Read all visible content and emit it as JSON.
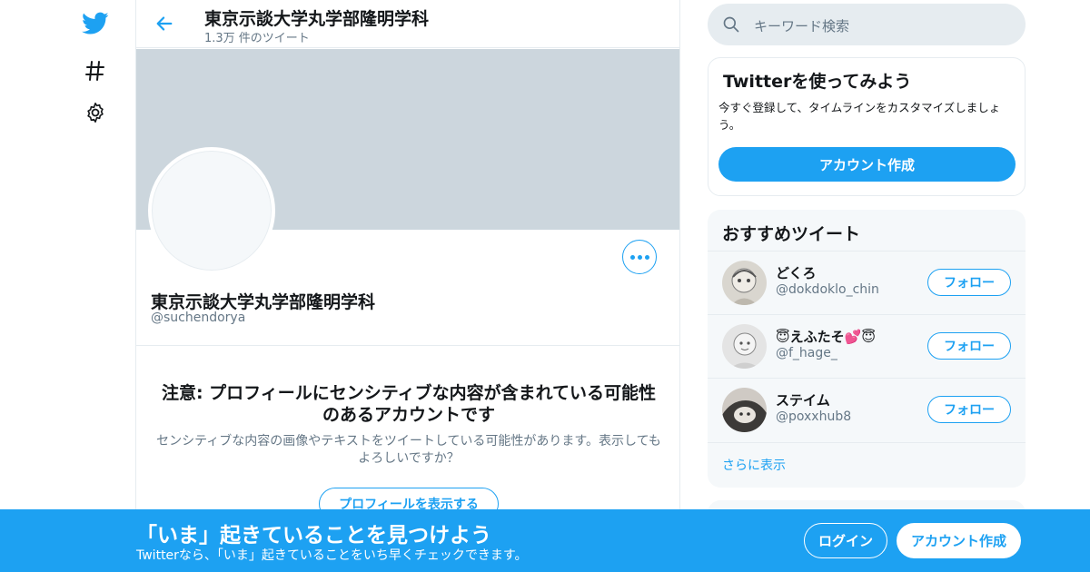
{
  "nav": {
    "icons": [
      "twitter-bird-icon",
      "hashtag-icon",
      "settings-gear-icon"
    ]
  },
  "header": {
    "title": "東京示談大学丸学部隆明学科",
    "tweet_count": "1.3万 件のツイート"
  },
  "profile": {
    "name": "東京示談大学丸学部隆明学科",
    "handle": "@suchendorya"
  },
  "warning": {
    "title": "注意: プロフィールにセンシティブな内容が含まれている可能性のあるアカウントです",
    "text": "センシティブな内容の画像やテキストをツイートしている可能性があります。表示してもよろしいですか？",
    "button_label": "プロフィールを表示する"
  },
  "search": {
    "placeholder": "キーワード検索"
  },
  "signup_card": {
    "title": "Twitterを使ってみよう",
    "text": "今すぐ登録して、タイムラインをカスタマイズしましょう。",
    "button_label": "アカウント作成"
  },
  "recommended": {
    "title": "おすすめツイート",
    "follow_label": "フォロー",
    "more_label": "さらに表示",
    "accounts": [
      {
        "name": "どくろ",
        "handle": "@dokdoklo_chin"
      },
      {
        "name": "😇えふたそ💕😇",
        "handle": "@f_hage_"
      },
      {
        "name": "ステイム",
        "handle": "@poxxhub8"
      }
    ]
  },
  "bottom_bar": {
    "title": "「いま」起きていることを見つけよう",
    "text": "Twitterなら、「いま」起きていることをいち早くチェックできます。",
    "login_label": "ログイン",
    "signup_label": "アカウント作成"
  },
  "colors": {
    "accent": "#1da1f2",
    "banner": "#ccd6dd",
    "secondary_text": "#657786"
  }
}
